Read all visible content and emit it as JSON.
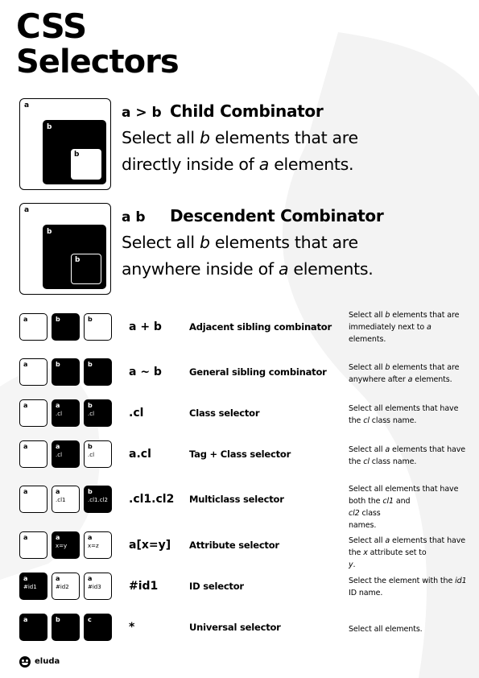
{
  "title": {
    "line1": "CSS",
    "line2": "Selectors"
  },
  "big": [
    {
      "symbol": "a > b",
      "name": "Child Combinator",
      "desc_line1": [
        "Select all ",
        "b",
        " elements that are"
      ],
      "desc_line2": [
        "directly inside of ",
        "a",
        " elements."
      ],
      "labels": {
        "outer": "a",
        "middle": "b",
        "inner": "b"
      }
    },
    {
      "symbol": "a b",
      "name": "Descendent Combinator",
      "desc_line1": [
        "Select all ",
        "b",
        " elements that are"
      ],
      "desc_line2": [
        "anywhere inside of ",
        "a",
        " elements."
      ],
      "labels": {
        "outer": "a",
        "middle": "b",
        "inner": "b"
      }
    }
  ],
  "rows": [
    {
      "boxes": [
        {
          "l": "a",
          "s": "",
          "dark": false
        },
        {
          "l": "b",
          "s": "",
          "dark": true
        },
        {
          "l": "b",
          "s": "",
          "dark": false
        }
      ],
      "symbol": "a + b",
      "name": "Adjacent sibling combinator",
      "desc": [
        [
          "Select all ",
          "b",
          " elements that are"
        ],
        [
          "immediately next to ",
          "a",
          ""
        ],
        [
          "elements.",
          "",
          ""
        ]
      ]
    },
    {
      "boxes": [
        {
          "l": "a",
          "s": "",
          "dark": false
        },
        {
          "l": "b",
          "s": "",
          "dark": true
        },
        {
          "l": "b",
          "s": "",
          "dark": true
        }
      ],
      "symbol": "a ~ b",
      "name": "General sibling combinator",
      "desc": [
        [
          "Select all ",
          "b",
          " elements that are"
        ],
        [
          "anywhere after ",
          "a",
          " elements."
        ]
      ]
    },
    {
      "boxes": [
        {
          "l": "a",
          "s": "",
          "dark": false
        },
        {
          "l": "a",
          "s": ".cl",
          "dark": true
        },
        {
          "l": "b",
          "s": ".cl",
          "dark": true
        }
      ],
      "symbol": ".cl",
      "name": "Class selector",
      "desc": [
        [
          "Select all elements that have",
          "",
          ""
        ],
        [
          "the ",
          "cl",
          " class name."
        ]
      ]
    },
    {
      "boxes": [
        {
          "l": "a",
          "s": "",
          "dark": false
        },
        {
          "l": "a",
          "s": ".cl",
          "dark": true
        },
        {
          "l": "b",
          "s": ".cl",
          "dark": false
        }
      ],
      "symbol": "a.cl",
      "name": "Tag + Class selector",
      "desc": [
        [
          "Select all ",
          "a",
          " elements that have"
        ],
        [
          "the ",
          "cl",
          " class name."
        ]
      ]
    },
    {
      "boxes": [
        {
          "l": "a",
          "s": "",
          "dark": false
        },
        {
          "l": "a",
          "s": ".cl1",
          "dark": false
        },
        {
          "l": "b",
          "s": ".cl1.cl2",
          "dark": true
        }
      ],
      "symbol": ".cl1.cl2",
      "name": "Multiclass selector",
      "desc": [
        [
          "Select all elements that have",
          "",
          ""
        ],
        [
          "both the ",
          "cl1",
          " and "
        ],
        [
          "",
          "cl2",
          " class"
        ],
        [
          "names.",
          "",
          ""
        ]
      ]
    },
    {
      "boxes": [
        {
          "l": "a",
          "s": "",
          "dark": false
        },
        {
          "l": "a",
          "s": "x=y",
          "dark": true
        },
        {
          "l": "a",
          "s": "x=z",
          "dark": false
        }
      ],
      "symbol": "a[x=y]",
      "name": "Attribute selector",
      "desc": [
        [
          "Select all ",
          "a",
          " elements that have"
        ],
        [
          "the ",
          "x",
          " attribute set to "
        ],
        [
          "",
          "y",
          "."
        ]
      ]
    },
    {
      "boxes": [
        {
          "l": "a",
          "s": "#id1",
          "dark": true
        },
        {
          "l": "a",
          "s": "#id2",
          "dark": false
        },
        {
          "l": "a",
          "s": "#id3",
          "dark": false
        }
      ],
      "symbol": "#id1",
      "name": "ID selector",
      "desc": [
        [
          "Select the element with the ",
          "id1",
          ""
        ],
        [
          "ID name.",
          "",
          ""
        ]
      ]
    },
    {
      "boxes": [
        {
          "l": "a",
          "s": "",
          "dark": true
        },
        {
          "l": "b",
          "s": "",
          "dark": true
        },
        {
          "l": "c",
          "s": "",
          "dark": true
        }
      ],
      "symbol": "*",
      "name": "Universal selector",
      "desc": [
        [
          "Select all elements.",
          "",
          ""
        ]
      ]
    }
  ],
  "brand": {
    "name": "eluda"
  }
}
